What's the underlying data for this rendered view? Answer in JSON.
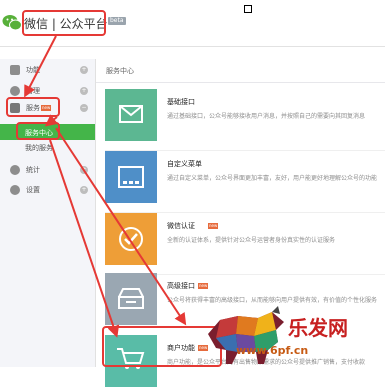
{
  "header": {
    "title": "微信 | 公众平台",
    "beta": "beta"
  },
  "sidebar": {
    "items": [
      {
        "label": "功能",
        "icon": "function-icon",
        "toggle": "+"
      },
      {
        "label": "管理",
        "icon": "manage-icon",
        "toggle": "+"
      },
      {
        "label": "服务",
        "icon": "service-icon",
        "toggle": "−",
        "badge": "new"
      },
      {
        "label": "统计",
        "icon": "stats-icon",
        "toggle": "+"
      },
      {
        "label": "设置",
        "icon": "settings-icon",
        "toggle": "+"
      }
    ],
    "subitems": [
      {
        "label": "服务中心",
        "active": true
      },
      {
        "label": "我的服务",
        "active": false
      }
    ]
  },
  "breadcrumb": "服务中心",
  "cards": [
    {
      "title": "基础接口",
      "desc": "通过基础接口，公众号能够接收用户消息，并按照自己的需要向其回复消息",
      "icon": "mail-icon",
      "color": "#5cb792"
    },
    {
      "title": "自定义菜单",
      "desc": "通过自定义菜单，公众号界面更加丰富，友好，用户能更好地理解公众号的功能",
      "icon": "menu-icon",
      "color": "#4f8fc8"
    },
    {
      "title": "微信认证",
      "desc": "全新的认证体系，提供针对公众号运营者身份真实性的认证服务",
      "icon": "check-icon",
      "color": "#ee9e37",
      "badge": "new"
    },
    {
      "title": "高级接口",
      "desc": "公众号将获得丰富的高级接口，从而能够向用户提供有效，有价值的个性化服务",
      "icon": "tray-icon",
      "color": "#9aa7b2",
      "badge": "new"
    },
    {
      "title": "商户功能",
      "desc": "商户功能，是公众平台向有出售物品需求的公众号提供推广销售，支付收款",
      "icon": "cart-icon",
      "color": "#59bca7",
      "badge": "new"
    }
  ],
  "watermark": {
    "url": "www.6pf.cn",
    "brand": "乐发网"
  },
  "colors": {
    "accent": "#44b549",
    "annotation": "#e53935"
  }
}
